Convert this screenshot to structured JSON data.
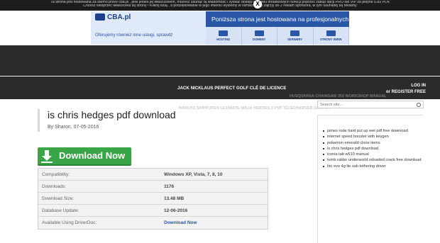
{
  "notice": {
    "lines": [
      "Ta strona jest hostowana za darmo przez cba.pl , jeśli jesteś jej właścicielem, możesz usunąć tą wiadomość i zyskać dostęp do wielu dodatkowych funkcji poprzez zakup opcji PRO lub VIP za jedyne 5.83 PLN",
      "Chcesz wesprzeć właściciela tej strony? Kliknij tutaj , a podziękowanie w jego imieniu wyślemy w ramach akcji zajrzyj do 2 reklam sponsora, w tym usuniętej tej reklamy"
    ],
    "close_label": "X"
  },
  "banner": {
    "logo": "CBA.pl",
    "headline": "Poniższa strona jest hostowana na profesjonalnych serwerach CBA.pl",
    "tagline": "Oferujemy również inne usługi, sprawdź",
    "products": [
      "HOSTING",
      "DOMENY",
      "SERWERY",
      "STRONY WWW"
    ]
  },
  "header": {
    "login": "LOG IN",
    "register": "or REGISTER FREE",
    "nav_main": "JACK NICKLAUS PERFECT GOLF CLÉ DE LICENCE",
    "nav_sub": "HUSQVARNA CHAINSAW 350 WORKSHOP MANUAL",
    "nav_sub2": "NARUTO SHIPPUDEN ULTIMATE NINJA HEROES 3 PSP TÉLÉCHARGER GRATUIT"
  },
  "article": {
    "title": "is chris hedges pdf download",
    "author": "By Sharon, 07-05-2016",
    "download_label": "Download Now",
    "info": [
      {
        "label": "Compatibility:",
        "value": "Windows XP, Vista, 7, 8, 10"
      },
      {
        "label": "Downloads:",
        "value": "1176"
      },
      {
        "label": "Download Size:",
        "value": "13.48 MB"
      },
      {
        "label": "Database Update:",
        "value": "12-06-2016"
      },
      {
        "label": "Available Using DriverDoc:",
        "value": "Download Now"
      }
    ]
  },
  "sidebar": {
    "search_placeholder": "Search site...",
    "items": [
      "james rode hard put up wet pdf free download",
      "internet speed booster with keygen",
      "pokemon emerald clone items",
      "is chris hedges pdf download",
      "iconia tab w510 manual",
      "tomb raider underworld reloaded crack free download",
      "htc evo 4g lte usb tethering driver"
    ]
  },
  "colors": {
    "header_bg": "#2b2b2b",
    "download_green": "#3aa547",
    "link_blue": "#2a56a6"
  }
}
